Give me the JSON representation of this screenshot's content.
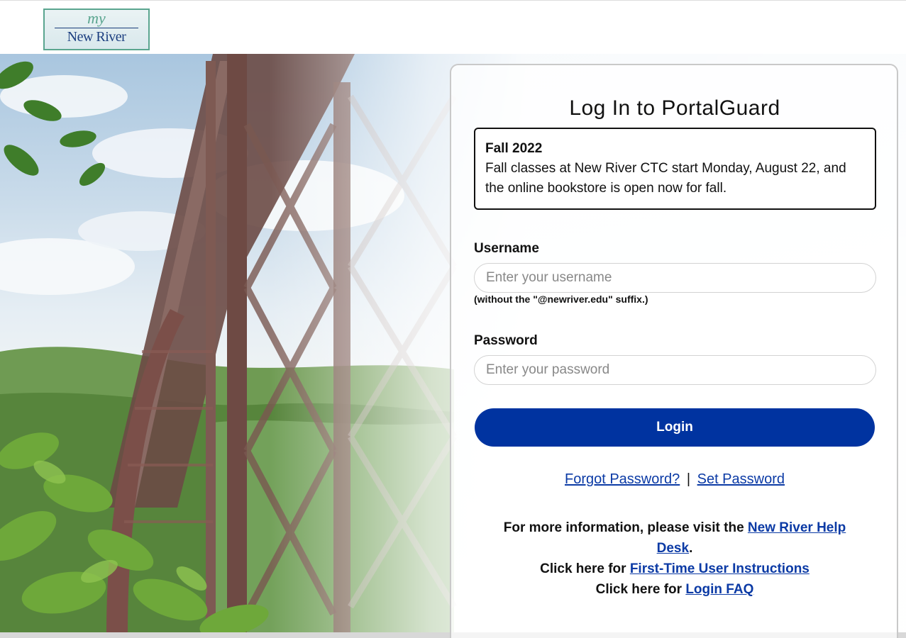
{
  "logo": {
    "top_text": "my",
    "name": "New River"
  },
  "card": {
    "title": "Log In to PortalGuard",
    "notice": {
      "title": "Fall 2022",
      "body": "Fall classes at New River CTC start Monday, August 22, and the online bookstore is open now for fall."
    },
    "username": {
      "label": "Username",
      "placeholder": "Enter your username",
      "value": "",
      "hint": "(without the \"@newriver.edu\" suffix.)"
    },
    "password": {
      "label": "Password",
      "placeholder": "Enter your password",
      "value": ""
    },
    "login_label": "Login",
    "links": {
      "forgot": "Forgot Password?",
      "separator": "|",
      "set": "Set Password"
    },
    "info": {
      "line1_prefix": "For more information, please visit the ",
      "line1_link": "New River Help Desk",
      "line1_suffix": ".",
      "line2_prefix": "Click here for ",
      "line2_link": "First-Time User Instructions",
      "line3_prefix": "Click here for ",
      "line3_link": "Login FAQ"
    }
  },
  "colors": {
    "primary": "#0033a0",
    "link": "#0b3aa5",
    "logo_green": "#5aa58f",
    "logo_blue": "#1c3f80"
  }
}
